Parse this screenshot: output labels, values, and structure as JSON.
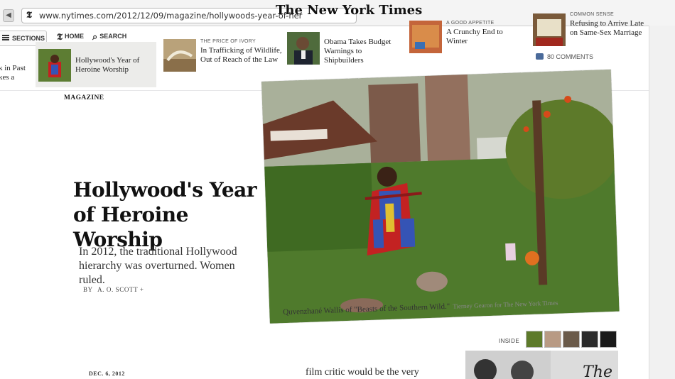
{
  "browser": {
    "back": "◀",
    "url": "www.nytimes.com/2012/12/09/magazine/hollywoods-year-of-her"
  },
  "header": {
    "logo": "The New York Times",
    "sections_label": "SECTIONS",
    "home_label": "HOME",
    "search_label": "SEARCH",
    "comments": "80 COMMENTS"
  },
  "ribbon": [
    {
      "kicker": "",
      "headline": "Hollywood's Year of Heroine Worship"
    },
    {
      "kicker": "THE PRICE OF IVORY",
      "headline": "In Trafficking of Wildlife, Out of Reach of the Law"
    },
    {
      "kicker": "",
      "headline": "Obama Takes Budget Warnings to Shipbuilders"
    },
    {
      "kicker": "A GOOD APPETITE",
      "headline": "A Crunchy End to Winter"
    },
    {
      "kicker": "COMMON SENSE",
      "headline": "Refusing to Arrive Late on Same-Sex Marriage"
    }
  ],
  "ribbon_partial": "k in Past\nkes a",
  "article": {
    "section": "MAGAZINE",
    "headline": "Hollywood's Year of Heroine Worship",
    "summary": "In 2012, the traditional Hollywood hierarchy was overturned. Women ruled.",
    "byline_prefix": "BY",
    "byline_author": "A. O. SCOTT",
    "byline_mark": "+",
    "caption": "Quvenzhané Wallis of \"Beasts of the Southern Wild.\"",
    "credit": "Tierney Gearon for The New York Times",
    "inside_label": "INSIDE",
    "date": "DEC. 6, 2012",
    "body_start": "film critic would be the very",
    "promo_text": "The"
  },
  "colors": {
    "photo_grass": "#4f7a2c",
    "photo_cape": "#c32222",
    "photo_suit": "#3554b5"
  }
}
